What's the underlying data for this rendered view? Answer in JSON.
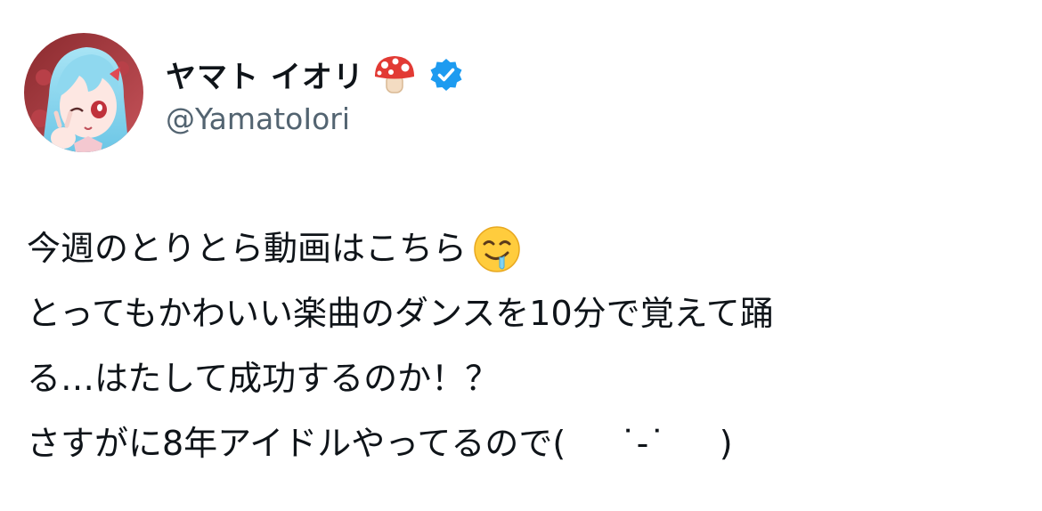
{
  "user": {
    "display_name": "ヤマト イオリ",
    "handle": "@YamatoIori",
    "name_emoji": "mushroom-icon",
    "verified": true,
    "verified_color": "#1d9bf0"
  },
  "tweet": {
    "line1": "今週のとりとら動画はこちら",
    "line1_emoji": "drooling-face-icon",
    "line2": "とってもかわいい楽曲のダンスを10分で覚えて踊",
    "line3": "る…はたして成功するのか！？",
    "line4": "さすがに8年アイドルやってるので(     ˙-˙     )"
  },
  "colors": {
    "text": "#0f1419",
    "handle": "#536471",
    "background": "#ffffff"
  }
}
